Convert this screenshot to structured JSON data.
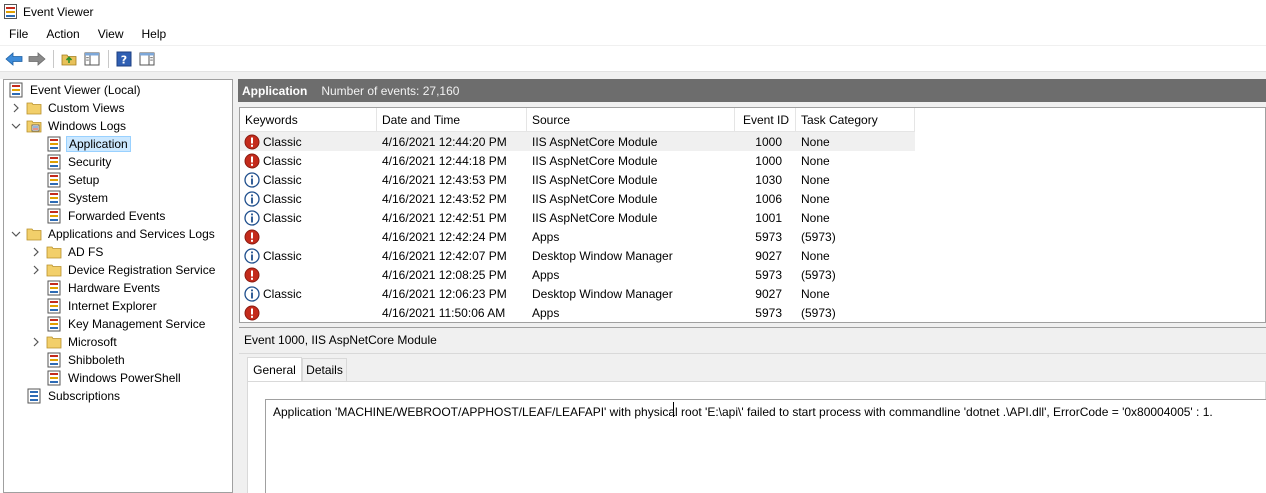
{
  "window": {
    "title": "Event Viewer"
  },
  "menu": [
    "File",
    "Action",
    "View",
    "Help"
  ],
  "toolbar": [
    "back-icon",
    "forward-icon",
    "up-folder-icon",
    "show-hide-tree-icon",
    "help-icon",
    "show-hide-action-pane-icon"
  ],
  "tree": {
    "root": "Event Viewer (Local)",
    "custom_views": "Custom Views",
    "windows_logs": "Windows Logs",
    "windows_logs_items": [
      "Application",
      "Security",
      "Setup",
      "System",
      "Forwarded Events"
    ],
    "app_services": "Applications and Services Logs",
    "app_services_items": [
      "AD FS",
      "Device Registration Service",
      "Hardware Events",
      "Internet Explorer",
      "Key Management Service",
      "Microsoft",
      "Shibboleth",
      "Windows PowerShell"
    ],
    "subscriptions": "Subscriptions"
  },
  "pane": {
    "title": "Application",
    "count": "Number of events: 27,160"
  },
  "grid": {
    "headers": [
      "Keywords",
      "Date and Time",
      "Source",
      "Event ID",
      "Task Category"
    ],
    "rows": [
      {
        "level": "error",
        "keywords": "Classic",
        "date": "4/16/2021 12:44:20 PM",
        "source": "IIS AspNetCore Module",
        "id": "1000",
        "task": "None"
      },
      {
        "level": "error",
        "keywords": "Classic",
        "date": "4/16/2021 12:44:18 PM",
        "source": "IIS AspNetCore Module",
        "id": "1000",
        "task": "None"
      },
      {
        "level": "info",
        "keywords": "Classic",
        "date": "4/16/2021 12:43:53 PM",
        "source": "IIS AspNetCore Module",
        "id": "1030",
        "task": "None"
      },
      {
        "level": "info",
        "keywords": "Classic",
        "date": "4/16/2021 12:43:52 PM",
        "source": "IIS AspNetCore Module",
        "id": "1006",
        "task": "None"
      },
      {
        "level": "info",
        "keywords": "Classic",
        "date": "4/16/2021 12:42:51 PM",
        "source": "IIS AspNetCore Module",
        "id": "1001",
        "task": "None"
      },
      {
        "level": "error",
        "keywords": "",
        "date": "4/16/2021 12:42:24 PM",
        "source": "Apps",
        "id": "5973",
        "task": "(5973)"
      },
      {
        "level": "info",
        "keywords": "Classic",
        "date": "4/16/2021 12:42:07 PM",
        "source": "Desktop Window Manager",
        "id": "9027",
        "task": "None"
      },
      {
        "level": "error",
        "keywords": "",
        "date": "4/16/2021 12:08:25 PM",
        "source": "Apps",
        "id": "5973",
        "task": "(5973)"
      },
      {
        "level": "info",
        "keywords": "Classic",
        "date": "4/16/2021 12:06:23 PM",
        "source": "Desktop Window Manager",
        "id": "9027",
        "task": "None"
      },
      {
        "level": "error",
        "keywords": "",
        "date": "4/16/2021 11:50:06 AM",
        "source": "Apps",
        "id": "5973",
        "task": "(5973)"
      }
    ]
  },
  "detail": {
    "title": "Event 1000, IIS AspNetCore Module",
    "tabs": [
      "General",
      "Details"
    ],
    "message": "Application 'MACHINE/WEBROOT/APPHOST/LEAF/LEAFAPI' with physical root 'E:\\api\\' failed to start process with commandline 'dotnet .\\API.dll', ErrorCode = '0x80004005' : 1."
  },
  "colors": {
    "header_bar": "#6d6d6d",
    "selection": "#cce8ff",
    "error": "#c42b1c",
    "info": "#1e4e8c"
  }
}
